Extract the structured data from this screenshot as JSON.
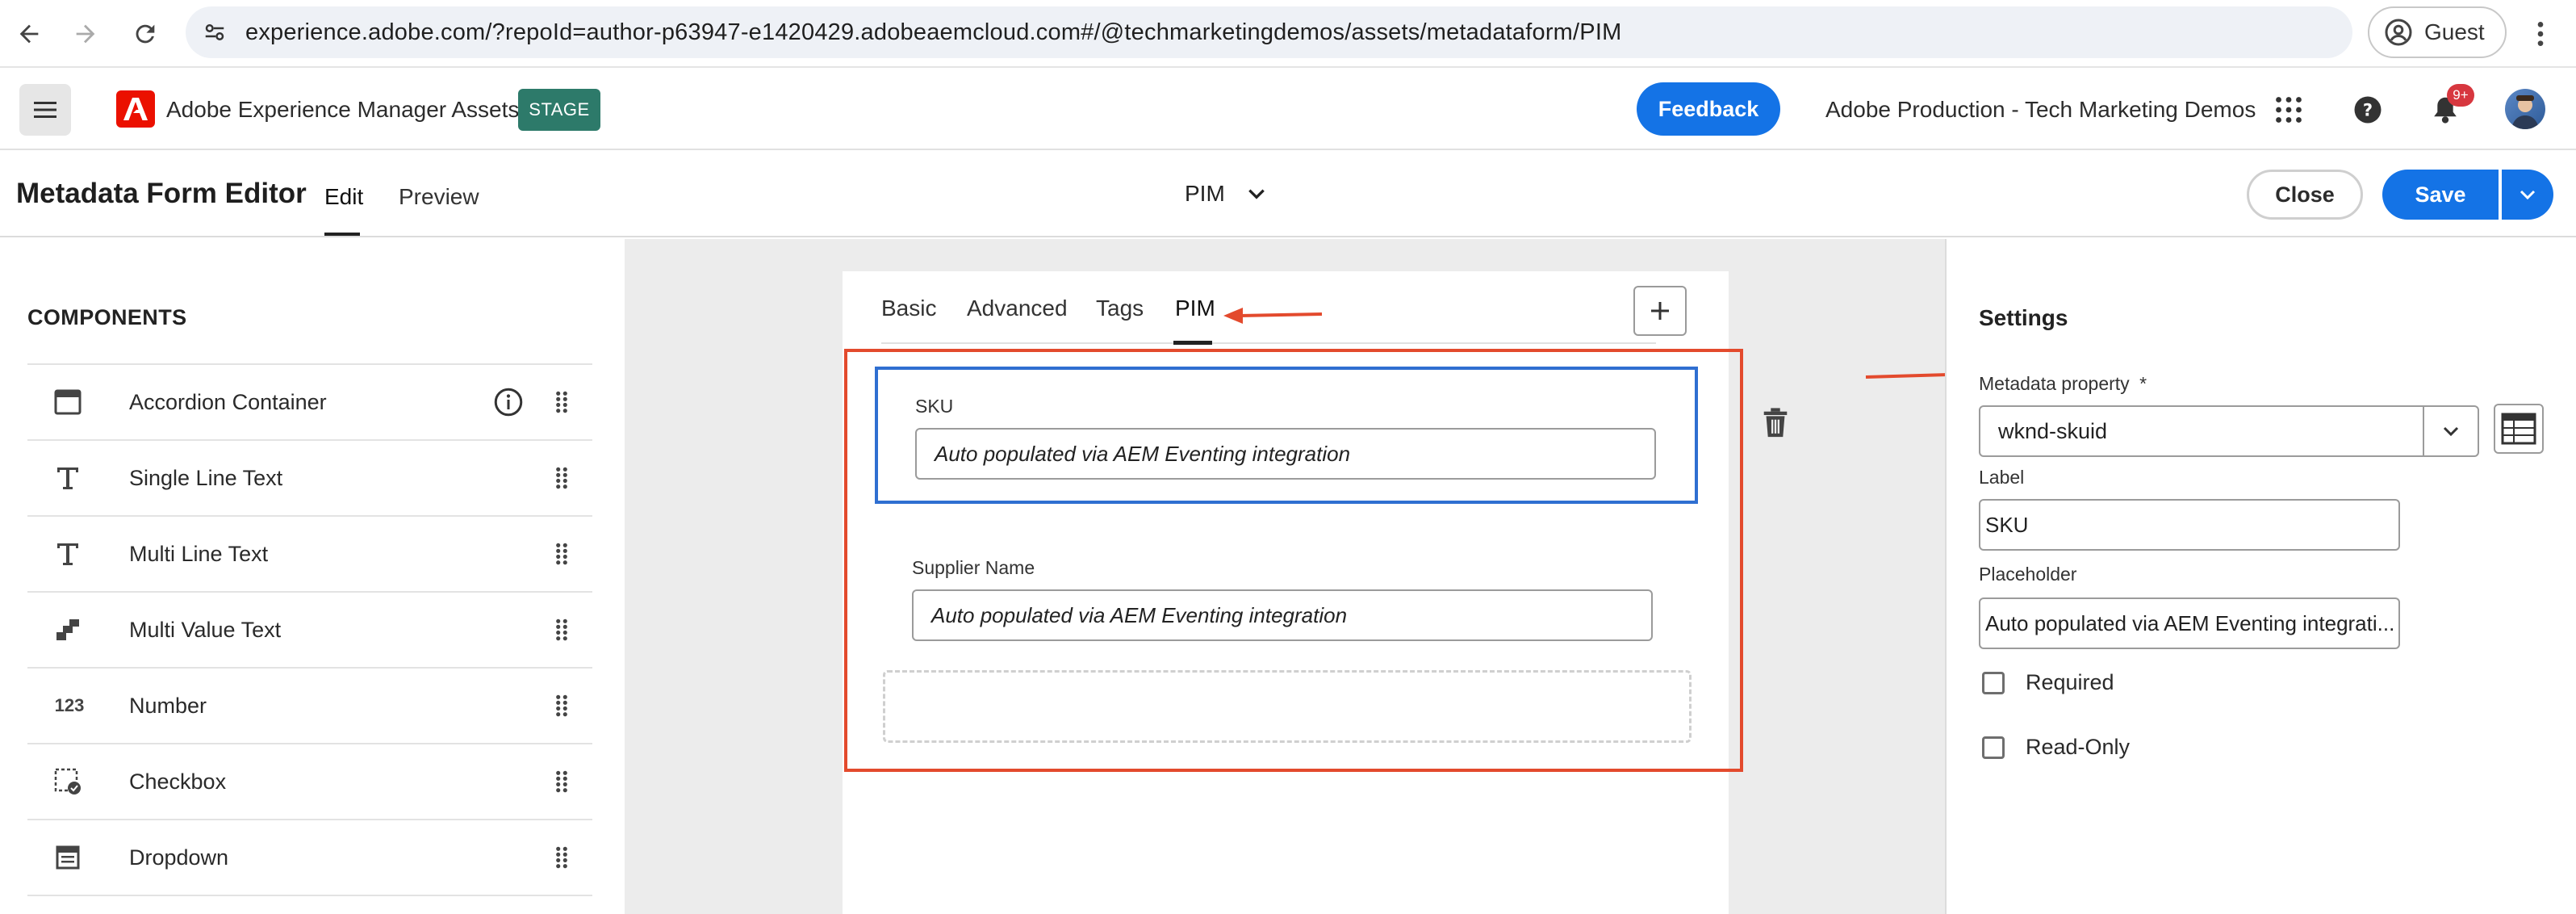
{
  "browser": {
    "url": "experience.adobe.com/?repoId=author-p63947-e1420429.adobeaemcloud.com#/@techmarketingdemos/assets/metadataform/PIM",
    "profile_label": "Guest"
  },
  "app": {
    "title": "Adobe Experience Manager Assets",
    "env_badge": "STAGE",
    "feedback_label": "Feedback",
    "org_name": "Adobe Production - Tech Marketing Demos",
    "notifications_count": "9+"
  },
  "editor": {
    "title": "Metadata Form Editor",
    "tabs": [
      {
        "label": "Edit",
        "active": true
      },
      {
        "label": "Preview",
        "active": false
      }
    ],
    "form_name": "PIM",
    "close_label": "Close",
    "save_label": "Save"
  },
  "components": {
    "heading": "COMPONENTS",
    "items": [
      {
        "label": "Accordion Container",
        "icon": "accordion-icon"
      },
      {
        "label": "Single Line Text",
        "icon": "text-icon"
      },
      {
        "label": "Multi Line Text",
        "icon": "text-icon"
      },
      {
        "label": "Multi Value Text",
        "icon": "multi-value-icon"
      },
      {
        "label": "Number",
        "icon": "number-icon",
        "glyph": "123"
      },
      {
        "label": "Checkbox",
        "icon": "checkbox-icon"
      },
      {
        "label": "Dropdown",
        "icon": "dropdown-icon"
      }
    ]
  },
  "form": {
    "tabs": [
      {
        "label": "Basic",
        "active": false
      },
      {
        "label": "Advanced",
        "active": false
      },
      {
        "label": "Tags",
        "active": false
      },
      {
        "label": "PIM",
        "active": true
      }
    ],
    "fields": [
      {
        "label": "SKU",
        "placeholder": "Auto populated via AEM Eventing integration",
        "selected": true
      },
      {
        "label": "Supplier Name",
        "placeholder": "Auto populated via AEM Eventing integration",
        "selected": false
      }
    ]
  },
  "settings": {
    "heading": "Settings",
    "metadata_property_label": "Metadata property",
    "required_marker": "*",
    "metadata_property_value": "wknd-skuid",
    "label_label": "Label",
    "label_value": "SKU",
    "placeholder_label": "Placeholder",
    "placeholder_value": "Auto populated via AEM Eventing integrati...",
    "required_label": "Required",
    "readonly_label": "Read-Only"
  },
  "colors": {
    "accent": "#1473e6",
    "annotation_red": "#e34a2d",
    "selection_blue": "#2f6fd1",
    "stage_green": "#2d7a6a"
  }
}
